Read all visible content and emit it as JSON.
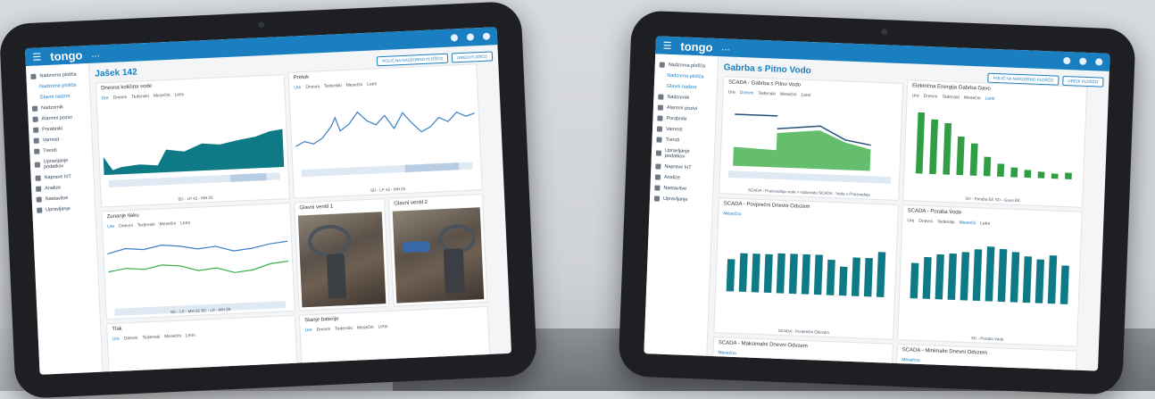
{
  "app": {
    "logo": "tongo",
    "logo_suffix": "..."
  },
  "left": {
    "page_title": "Jašek 142",
    "sidebar": [
      "Nadzorna plošča",
      "Nadzorna plošča",
      "Glavni nadzor",
      "Nadzornik",
      "Alarmni pozivi",
      "Porabniki",
      "Varnost",
      "Trendi",
      "Upravljanje podatkov",
      "Naprave IoT",
      "Analize",
      "Nastavitve",
      "Upravljanje"
    ],
    "buttons": [
      "POLIČ NA NADZORNO PLOŠČO",
      "UREDI PLOŠČO"
    ],
    "card1": {
      "title": "Dnevna količina vode",
      "tabs": [
        "Ure",
        "Dnevni",
        "Tedenski",
        "Mesečni",
        "Letni"
      ],
      "legend": "SD - LP 42 - MH 25"
    },
    "card2": {
      "title": "Pretok",
      "tabs": [
        "Ure",
        "Dnevni",
        "Tedenski",
        "Mesečni",
        "Letni"
      ],
      "legend": "SD - LP 42 - MH 25"
    },
    "card3": {
      "title": "Zunanje tlaku",
      "tabs": [
        "Ure",
        "Dnevni",
        "Tedenski",
        "Mesečni",
        "Letni"
      ],
      "legend": "SD - LP - MH 25  SD - LP - MH 28"
    },
    "card4": {
      "title": "Glavni ventil 1"
    },
    "card5": {
      "title": "Glavni ventil 2"
    },
    "card6": {
      "title": "Tlak",
      "tabs": [
        "Ure",
        "Dnevni",
        "Tedenski",
        "Mesečni",
        "Letni"
      ]
    },
    "card7": {
      "title": "Stanje baterije",
      "tabs": [
        "Ure",
        "Dnevni",
        "Tedenski",
        "Mesečni",
        "Letni"
      ]
    }
  },
  "right": {
    "page_title": "Gabrba s Pitno Vodo",
    "buttons": [
      "POLIČ NA NADZORNO PLOŠČO",
      "UREDI PLOŠČO"
    ],
    "card1": {
      "title": "SCADA - Gabrba s Pitno Vodo",
      "tabs": [
        "Ure",
        "Dnevni",
        "Tedenski",
        "Mesečni",
        "Letni"
      ],
      "legend": "SCADA - Proizvodnja vode v vodovodu  SCADA - Voda v Proizvodnja"
    },
    "card2": {
      "title": "Električna Energija Gabrba Gavo",
      "tabs": [
        "Ure",
        "Dnevni",
        "Tedenski",
        "Mesečni",
        "Letni"
      ],
      "legend": "SD - Poraba EE  SD - Gavo EE"
    },
    "card3": {
      "title": "SCADA - Povprečni Dnevni Odvzem",
      "tabs": [
        "Mesečno"
      ],
      "legend": "SCADA - Povprečni Odvzem"
    },
    "card4": {
      "title": "SCADA - Poraba Vode",
      "tabs": [
        "Ure",
        "Dnevni",
        "Tedenski",
        "Mesečni",
        "Letni"
      ],
      "legend": "SD - Poraba Vode"
    },
    "card5": {
      "title": "SCADA - Maksimalni Dnevni Odvzem",
      "tabs": [
        "Mesečno"
      ]
    },
    "card6": {
      "title": "SCADA - Minimalni Dnevni Odvzem",
      "tabs": [
        "Mesečno"
      ]
    }
  },
  "colors": {
    "brand": "#1a7fc1",
    "teal": "#0e7a86",
    "green": "#3fae49",
    "blue_line": "#3b7fc4"
  }
}
